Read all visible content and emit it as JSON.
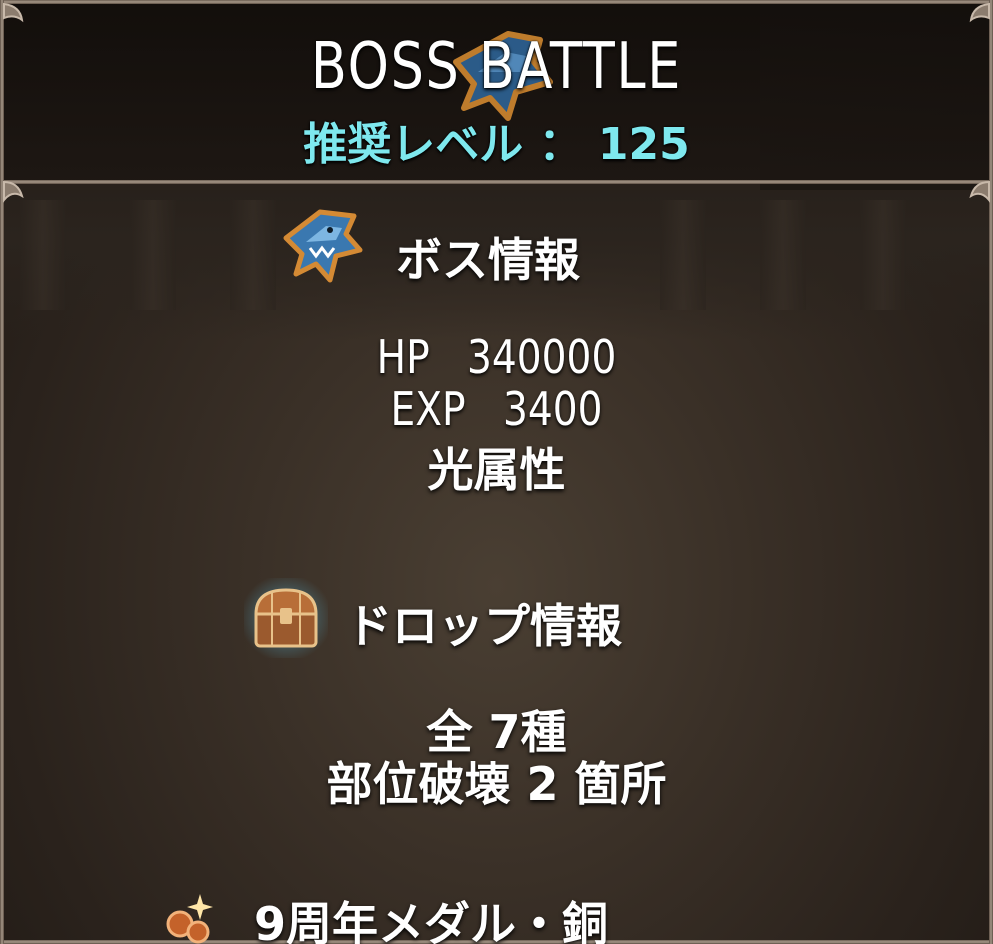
{
  "header": {
    "title": "BOSS BATTLE",
    "recommended_level": "推奨レベル ： 125"
  },
  "boss_info": {
    "heading": "ボス情報",
    "icon": "shark-head-icon",
    "hp_label": "HP",
    "hp_value": "340000",
    "exp_label": "EXP",
    "exp_value": "3400",
    "attribute": "光属性"
  },
  "drop_info": {
    "heading": "ドロップ情報",
    "icon": "treasure-chest-icon",
    "total": "全 7種",
    "part_break": "部位破壊 2 箇所"
  },
  "reward_item": {
    "label": "9周年メダル・銅",
    "icon": "medal-icon"
  },
  "colors": {
    "level_text": "#7ee8ee",
    "title_text": "#ffffff",
    "frame": "#a8998a",
    "background": "#3a3027"
  }
}
